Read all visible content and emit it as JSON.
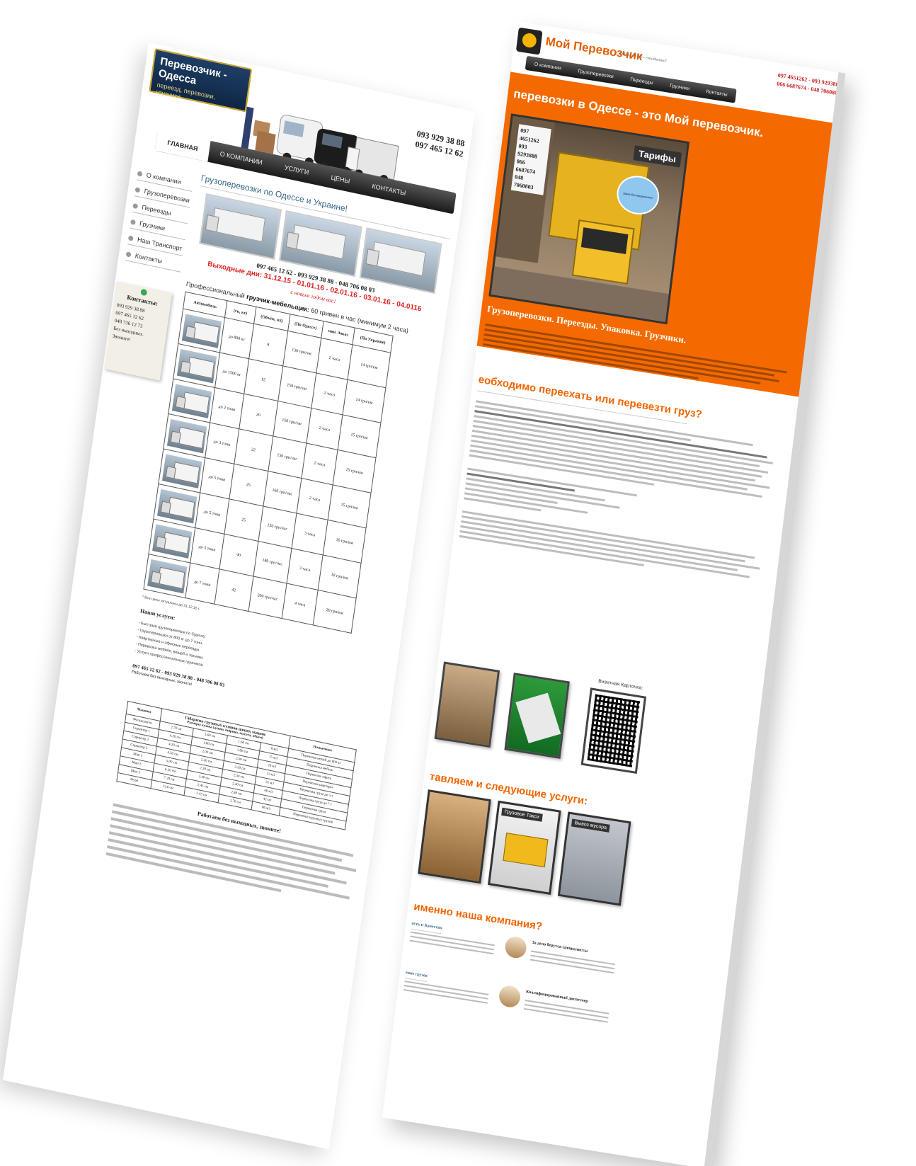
{
  "left_site": {
    "logo": {
      "title": "Перевозчик - Одесса",
      "tagline": "переезд, перевозки, грузчики"
    },
    "phones": [
      "093 929 38 88",
      "097 465 12 62"
    ],
    "nav": [
      "Главная",
      "О компании",
      "Услуги",
      "Цены",
      "Контакты"
    ],
    "sidebar": [
      "О компании",
      "Грузоперевозки",
      "Переезды",
      "Грузчики",
      "Наш Транспорт",
      "Контакты"
    ],
    "note": {
      "title": "Контакты:",
      "lines": [
        "093 929 38 88",
        "097 465 12 62",
        "048 736 12 73",
        "Без выходных. Звоните!"
      ]
    },
    "main_title": "Грузоперевозки по Одессе и Украине!",
    "promo": {
      "phones": "097 465 12 62 - 093 929 38 88 - 048 706 08 03",
      "holidays": "Выходные дни: 31.12.15 - 01.01.16 - 02.01.16 - 03.01.16 - 04.0116",
      "new_year": "с новым годом вас!"
    },
    "movers": {
      "prefix": "Профессиональный",
      "bold": "грузчик-мебельщик:",
      "suffix": "60 гривен в час (минимум 2 часа)"
    },
    "rates_headers": [
      "Автомобиль",
      "(гп, кг)",
      "(Объём, м3)",
      "(По Одессе)",
      "мин. Заказ",
      "(По Украине)"
    ],
    "rates_rows": [
      {
        "load": "до 800 кг",
        "volume": "8",
        "city": "130 грн/час",
        "min": "2 часа",
        "ukraine": "14 грн/км"
      },
      {
        "load": "до 1500 кг",
        "volume": "15",
        "city": "150 грн/час",
        "min": "2 часа",
        "ukraine": "14 грн/км"
      },
      {
        "load": "до 2 тонн",
        "volume": "20",
        "city": "150 грн/час",
        "min": "2 часа",
        "ukraine": "15 грн/км"
      },
      {
        "load": "до 3 тонн",
        "volume": "22",
        "city": "150 грн/час",
        "min": "2 часа",
        "ukraine": "15 грн/км"
      },
      {
        "load": "до 5 тонн",
        "volume": "25",
        "city": "160 грн/час",
        "min": "2 часа",
        "ukraine": "15 грн/км"
      },
      {
        "load": "до 5 тонн",
        "volume": "25",
        "city": "150 грн/час",
        "min": "3 часа",
        "ukraine": "16 грн/км"
      },
      {
        "load": "до 5 тонн",
        "volume": "40",
        "city": "180 грн/час",
        "min": "3 часа",
        "ukraine": "18 грн/км"
      },
      {
        "load": "до 7 тонн",
        "volume": "42",
        "city": "200 грн/час",
        "min": "4 часа",
        "ukraine": "20 грн/км"
      }
    ],
    "footnote": "* Все цены актуальны до 31.12.15 г.",
    "services_title": "Наши услуги:",
    "services": [
      "- Быстрые грузоперевозки по Одессе.",
      "- Грузоперевозки от 800 кг до 7 тонн.",
      "- Квартирные и офисные переезды.",
      "- Перевозка мебели, вещей и техники.",
      "- Услуги профессиональных грузчиков."
    ],
    "contact_line": "097 465 12 62 - 093 929 38 88 - 048 706 08 03",
    "contact_sub": "Работаем без выходных, звоните!",
    "dims_caption": "Габариты грузовых кузовов наших машин.",
    "dims_headers": [
      "Машина",
      "Размеры кузова (длина, ширина, высота, объём)",
      "Назначение"
    ],
    "dims_rows": [
      {
        "car": "Фольксваген",
        "c1": "2.70 см",
        "c2": "1.60 см",
        "c3": "1.60 см",
        "c4": "8 м3",
        "use": "Перевозка вещей до 800 кг"
      },
      {
        "car": "Спринтер 1",
        "c1": "4.20 см",
        "c2": "1.80 см",
        "c3": "1.80 см",
        "c4": "15 м3",
        "use": "Перевозка мебели"
      },
      {
        "car": "Спринтер 2",
        "c1": "4.20 см",
        "c2": "2.00 см",
        "c3": "2.00 см",
        "c4": "20 м3",
        "use": "Перевозка офиса"
      },
      {
        "car": "Спринтер 3",
        "c1": "4.50 см",
        "c2": "2.20 см",
        "c3": "2.20 см",
        "c4": "22 м3",
        "use": "Перевозка квартиры"
      },
      {
        "car": "Ман 1",
        "c1": "5.00 см",
        "c2": "2.20 см",
        "c3": "2.30 см",
        "c4": "25 м3",
        "use": "Перевозка груза до 5 т"
      },
      {
        "car": "Ман 2",
        "c1": "6.20 см",
        "c2": "2.40 см",
        "c3": "2.40 см",
        "c4": "40 м3",
        "use": "Перевозка груза до 7 т"
      },
      {
        "car": "Ман 3",
        "c1": "7.20 см",
        "c2": "2.45 см",
        "c3": "2.40 см",
        "c4": "42 м3",
        "use": "Перевозка груза"
      },
      {
        "car": "Фура",
        "c1": "13.6 см",
        "c2": "2.45 см",
        "c3": "2.70 см",
        "c4": "86 м3",
        "use": "Перевозка крупных грузов"
      }
    ],
    "bottom_head": "Работаем без выходных, звоните!"
  },
  "right_site": {
    "brand": "Мой Перевозчик",
    "hours": "с 8:00 до 21:00 - ежедневно!",
    "phones": [
      "097 4651262 - 093 9293888",
      "066 6687674 - 048 7060803"
    ],
    "nav": [
      "О компании",
      "Грузоперевозки",
      "Переезды",
      "Грузчики",
      "Контакты"
    ],
    "headline": "перевозки в Одессе - это Мой перевозчик.",
    "hero_phones": [
      "097 4651262",
      "093 9293888",
      "066 6687674",
      "048 7060803"
    ],
    "tariff_label": "Тарифы",
    "bubble_text": "Заказ без предоплаты!",
    "subhead": "Грузоперевозки. Переезды. Упаковка. Грузчики.",
    "question": "еобходимо переехать или перевезти груз?",
    "card_label": "Визитная Карточка:",
    "offer_title": "тавляем и следующие услуги:",
    "offer_cards": [
      "Грузовое Такси",
      "Вывоз мусора"
    ],
    "why_title": "именно наша компания?",
    "features": [
      {
        "left": "ость и Качество",
        "right": "За дело берутся специалисты"
      },
      {
        "left": "ение грузов",
        "right": "Квалифицированный диспетчер"
      }
    ]
  }
}
